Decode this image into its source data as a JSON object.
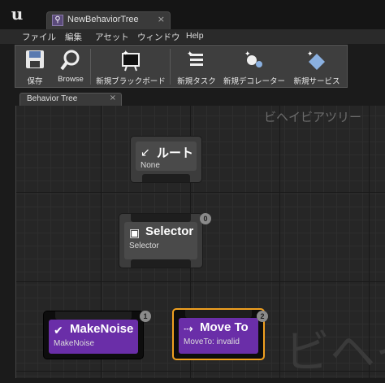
{
  "app": {
    "tab_title": "NewBehaviorTree",
    "tab_close": "×"
  },
  "menu": [
    "ファイル",
    "編集",
    "アセット",
    "ウィンドウ",
    "Help"
  ],
  "toolbar": {
    "buttons": [
      {
        "label": "保存",
        "icon": "save-icon"
      },
      {
        "label": "Browse",
        "icon": "browse-magnifier-icon"
      },
      {
        "label": "新規ブラックボード",
        "icon": "blackboard-icon"
      },
      {
        "label": "新規タスク",
        "icon": "task-icon"
      },
      {
        "label": "新規デコレーター",
        "icon": "decorator-icon"
      },
      {
        "label": "新規サービス",
        "icon": "service-icon"
      }
    ]
  },
  "panel": {
    "tab_label": "Behavior Tree",
    "tab_close": "×",
    "graph_title": "ビヘイビアツリー",
    "watermark": "ビヘイ"
  },
  "nodes": {
    "root": {
      "title": "ルート",
      "subtitle": "None"
    },
    "selector": {
      "title": "Selector",
      "subtitle": "Selector",
      "badge": "0"
    },
    "makenoise": {
      "title": "MakeNoise",
      "subtitle": "MakeNoise",
      "badge": "1"
    },
    "moveto": {
      "title": "Move To",
      "subtitle": "MoveTo: invalid",
      "badge": "2"
    }
  },
  "colors": {
    "task_purple": "#6a2ea8",
    "selection_orange": "#f0a020",
    "graph_bg": "#262626"
  }
}
